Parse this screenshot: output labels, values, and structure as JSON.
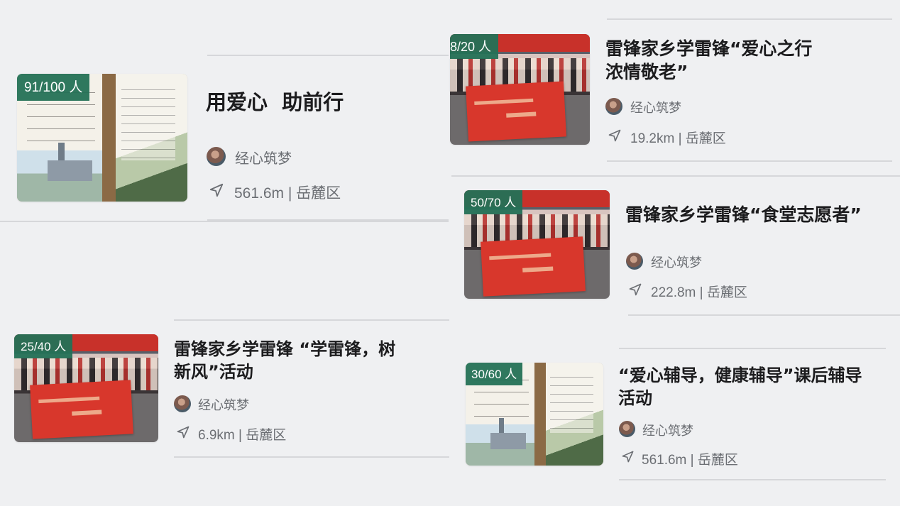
{
  "cards": [
    {
      "badge": "91/100 人",
      "title_lines": [
        "用爱心  助前行"
      ],
      "author": "经心筑梦",
      "location": "561.6m | 岳麓区",
      "image": "poster"
    },
    {
      "badge": "8/20 人",
      "title_lines": [
        "雷锋家乡学雷锋“爱心之行",
        "浓情敬老”"
      ],
      "author": "经心筑梦",
      "location": "19.2km | 岳麓区",
      "image": "group-photo"
    },
    {
      "badge": "50/70 人",
      "title_lines": [
        "雷锋家乡学雷锋“食堂志愿者”"
      ],
      "author": "经心筑梦",
      "location": "222.8m | 岳麓区",
      "image": "group-photo"
    },
    {
      "badge": "25/40 人",
      "title_lines": [
        "雷锋家乡学雷锋 “学雷锋，树",
        "新风”活动"
      ],
      "author": "经心筑梦",
      "location": "6.9km | 岳麓区",
      "image": "group-photo"
    },
    {
      "badge": "30/60 人",
      "title_lines": [
        "“爱心辅导，健康辅导”课后辅导",
        "活动"
      ],
      "author": "经心筑梦",
      "location": "561.6m | 岳麓区",
      "image": "poster"
    }
  ],
  "icons": {
    "location": "navigation-arrow-icon",
    "avatar": "author-avatar"
  },
  "colors": {
    "badge": "#247156",
    "background": "#eff0f2",
    "title": "#1c1c1e",
    "meta": "#6b6e73"
  }
}
